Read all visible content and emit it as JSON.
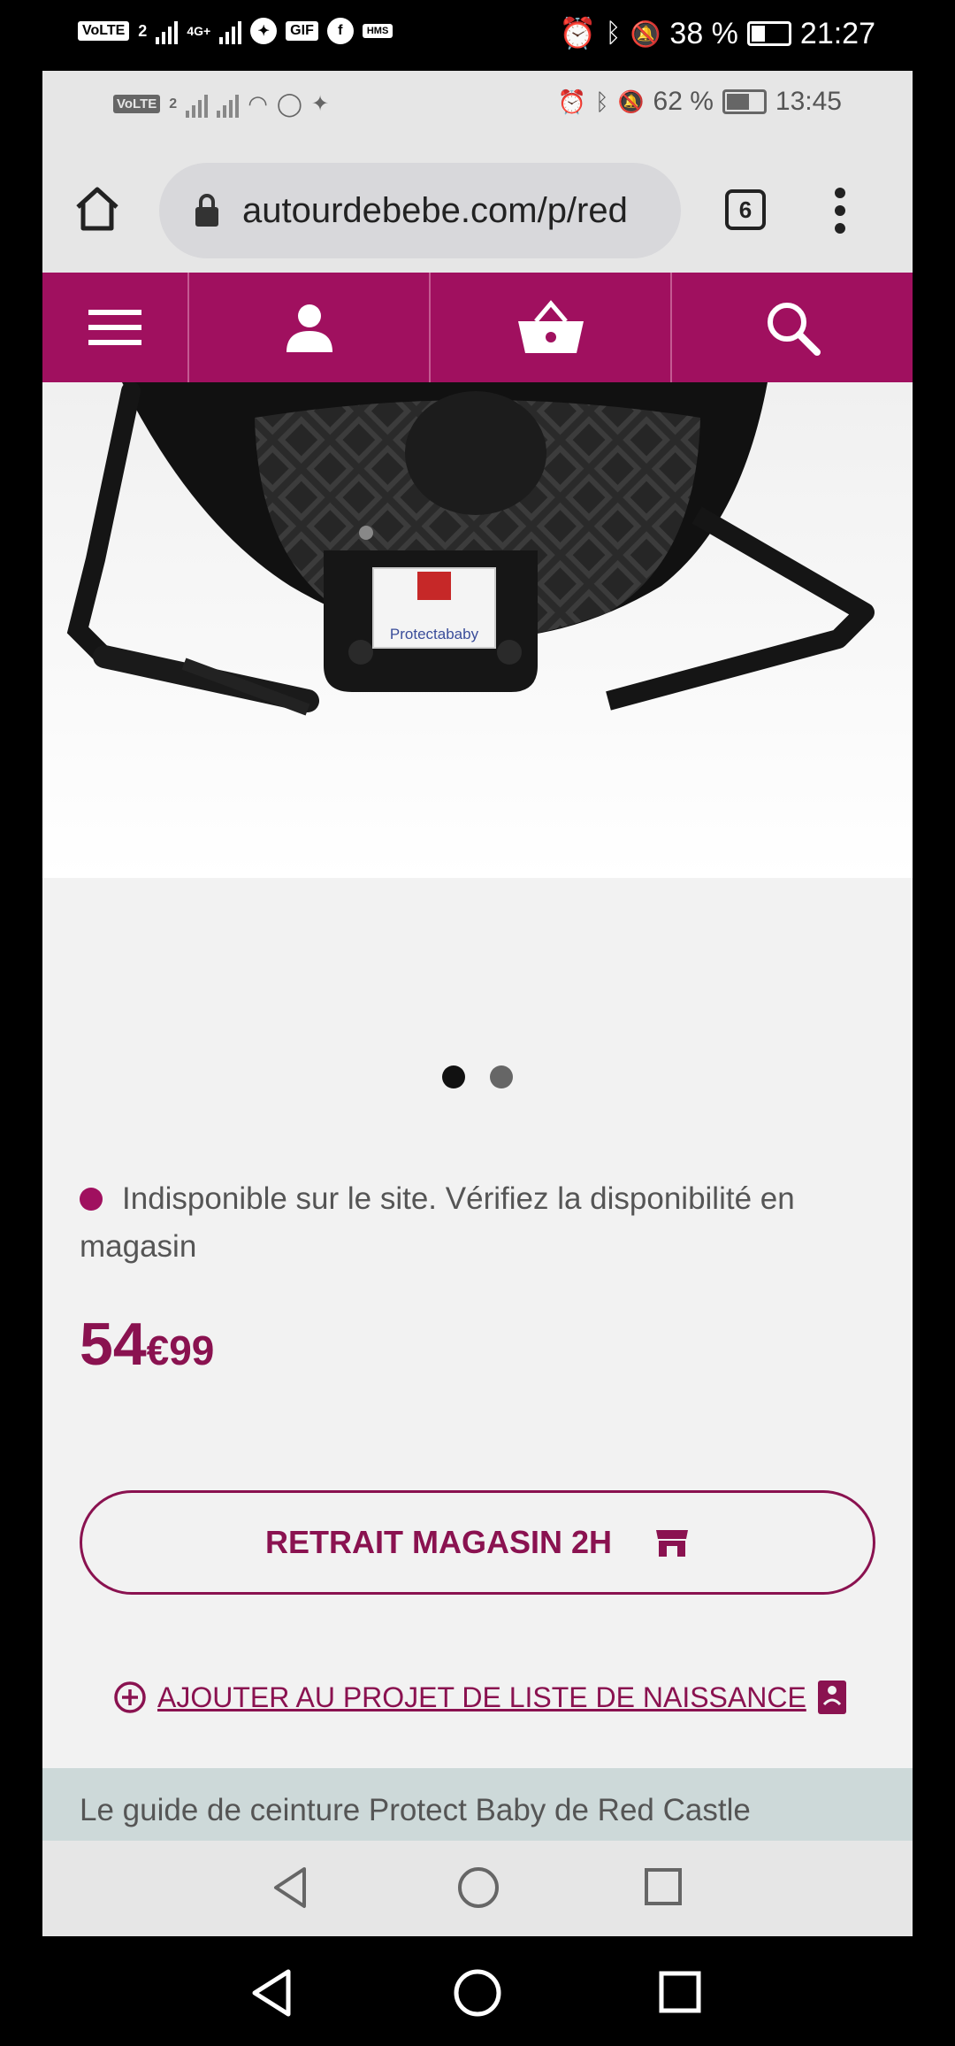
{
  "outer_status": {
    "volte_label": "VoLTE",
    "sim_number": "2",
    "network_label": "4G+",
    "gif_label": "GIF",
    "hms_label": "HMS",
    "battery_text": "38 %",
    "time": "21:27",
    "battery_level": 0.38
  },
  "inner_status": {
    "volte_label": "VoLTE",
    "sim_number": "2",
    "battery_text": "62 %",
    "time": "13:45",
    "battery_level": 0.62
  },
  "browser": {
    "url": "autourdebebe.com/p/red",
    "tab_count": "6"
  },
  "product": {
    "label_text": "Protectababy",
    "carousel_active_index": 0,
    "availability": "Indisponible sur le site. Vérifiez la disponibilité en magasin",
    "price_euros": "54",
    "price_cents": "€99",
    "store_button": "RETRAIT MAGASIN 2H",
    "birth_list_link": "AJOUTER AU PROJET DE LISTE DE NAISSANCE",
    "guide_text": "Le guide de ceinture Protect Baby de Red Castle"
  },
  "colors": {
    "brand": "#a0105f",
    "brand_dark": "#8a1250"
  },
  "icons": [
    "home-icon",
    "lock-icon",
    "hamburger-icon",
    "user-icon",
    "basket-icon",
    "search-icon",
    "store-icon",
    "plus-circle-icon",
    "gift-icon",
    "back-icon",
    "home-nav-icon",
    "recents-icon"
  ]
}
